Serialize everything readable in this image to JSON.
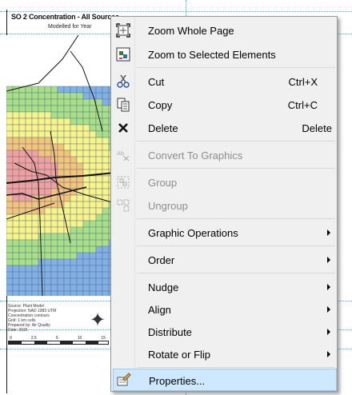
{
  "layout_view": {
    "map_title": "SO 2 Concentration - All Sources",
    "map_subtitle": "Modelled for Year",
    "legend_lines": [
      "Source: Plant Model",
      "Projection: NAD 1983 UTM",
      "Concentration contours",
      "Grid: 1 km cells",
      "Prepared by: Air Quality",
      "Date: 2015"
    ],
    "scale_labels": [
      "0",
      "2.5",
      "5",
      "10",
      "15"
    ],
    "grid_colors": {
      "blue": "#7fb0e8",
      "green": "#a8e08a",
      "yellow": "#f6f48b",
      "orange": "#f4c47c",
      "red": "#f0a0a0",
      "grid_line": "#5a6a7a"
    }
  },
  "context_menu": {
    "items": [
      {
        "label": "Zoom Whole Page",
        "shortcut": "",
        "icon": "zoom-whole-page-icon",
        "enabled": true,
        "submenu": false
      },
      {
        "label": "Zoom to Selected Elements",
        "shortcut": "",
        "icon": "zoom-selected-elements-icon",
        "enabled": true,
        "submenu": false
      },
      {
        "label": "Cut",
        "shortcut": "Ctrl+X",
        "icon": "scissors-icon",
        "enabled": true,
        "submenu": false
      },
      {
        "label": "Copy",
        "shortcut": "Ctrl+C",
        "icon": "copy-icon",
        "enabled": true,
        "submenu": false
      },
      {
        "label": "Delete",
        "shortcut": "Delete",
        "icon": "delete-x-icon",
        "enabled": true,
        "submenu": false
      },
      {
        "label": "Convert To Graphics",
        "shortcut": "",
        "icon": "convert-graphics-icon",
        "enabled": false,
        "submenu": false
      },
      {
        "label": "Group",
        "shortcut": "",
        "icon": "group-icon",
        "enabled": false,
        "submenu": false
      },
      {
        "label": "Ungroup",
        "shortcut": "",
        "icon": "ungroup-icon",
        "enabled": false,
        "submenu": false
      },
      {
        "label": "Graphic Operations",
        "shortcut": "",
        "icon": "",
        "enabled": true,
        "submenu": true
      },
      {
        "label": "Order",
        "shortcut": "",
        "icon": "",
        "enabled": true,
        "submenu": true
      },
      {
        "label": "Nudge",
        "shortcut": "",
        "icon": "",
        "enabled": true,
        "submenu": true
      },
      {
        "label": "Align",
        "shortcut": "",
        "icon": "",
        "enabled": true,
        "submenu": true
      },
      {
        "label": "Distribute",
        "shortcut": "",
        "icon": "",
        "enabled": true,
        "submenu": true
      },
      {
        "label": "Rotate or Flip",
        "shortcut": "",
        "icon": "",
        "enabled": true,
        "submenu": true
      },
      {
        "label": "Properties...",
        "shortcut": "",
        "icon": "properties-icon",
        "enabled": true,
        "submenu": false,
        "highlighted": true
      }
    ]
  }
}
